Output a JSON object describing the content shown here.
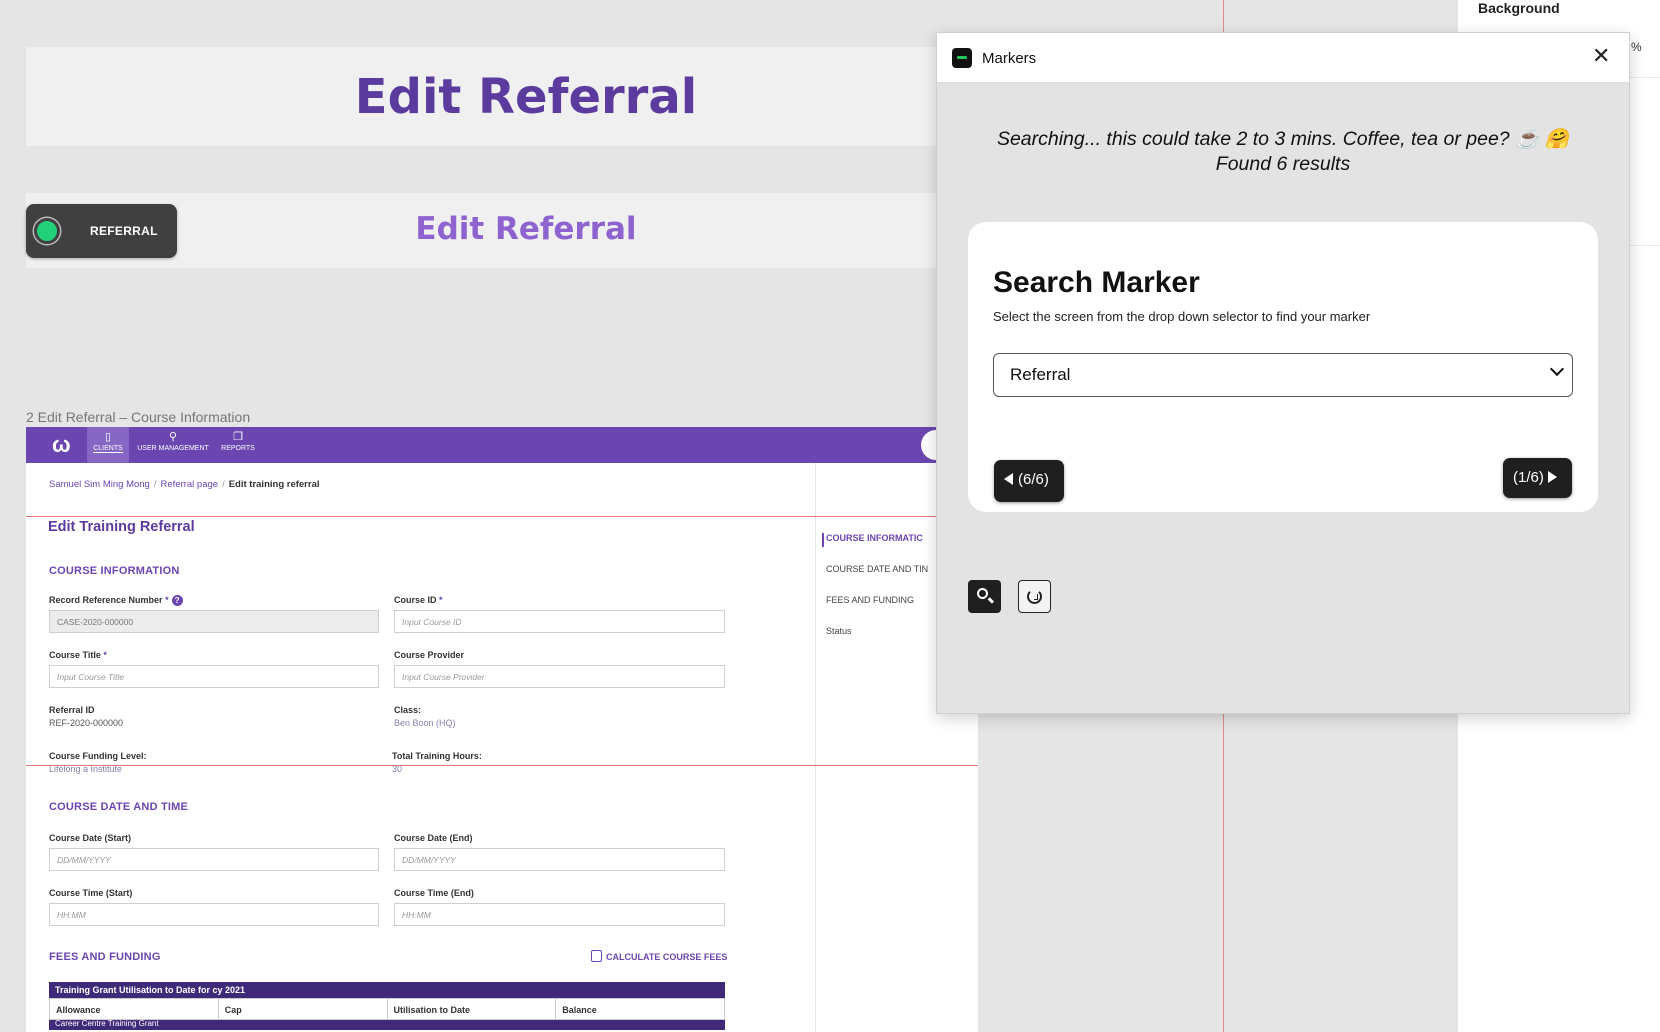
{
  "design_panel": {
    "background_label": "Background",
    "percent_fragment": "%"
  },
  "banners": {
    "main_title": "Edit Referral",
    "sub_title": "Edit Referral",
    "marker_pill_label": "REFERRAL",
    "marker_pill_color": "#22d07a"
  },
  "frame": {
    "label": "2 Edit Referral – Course Information"
  },
  "app": {
    "nav": {
      "logo": "ω",
      "items": [
        {
          "label": "CLIENTS",
          "icon": "clients-icon"
        },
        {
          "label": "USER MANAGEMENT",
          "icon": "user-icon"
        },
        {
          "label": "REPORTS",
          "icon": "reports-icon"
        }
      ]
    },
    "breadcrumb": [
      "Samuel Sim Ming Mong",
      "Referral page",
      "Edit training referral"
    ],
    "page_title": "Edit Training Referral",
    "side_nav": [
      "COURSE INFORMATIC",
      "COURSE DATE AND TIN",
      "FEES AND FUNDING",
      "Status"
    ],
    "sections": {
      "course_info": "COURSE INFORMATION",
      "course_date": "COURSE DATE AND TIME",
      "fees": "FEES AND FUNDING"
    },
    "fields": {
      "record_ref_label": "Record Reference Number",
      "record_ref_value": "CASE-2020-000000",
      "course_id_label": "Course ID",
      "course_id_placeholder": "Input Course ID",
      "course_title_label": "Course Title",
      "course_title_placeholder": "Input Course Title",
      "course_provider_label": "Course Provider",
      "course_provider_placeholder": "Input Course Provider",
      "referral_id_label": "Referral ID",
      "referral_id_value": "REF-2020-000000",
      "class_label": "Class:",
      "class_value": "Ben Boon (HQ)",
      "funding_level_label": "Course Funding Level:",
      "funding_level_value": "Lifelong a Institute",
      "total_hours_label": "Total Training Hours:",
      "total_hours_value": "30",
      "date_start_label": "Course Date (Start)",
      "date_start_placeholder": "DD/MM/YYYY",
      "date_end_label": "Course Date (End)",
      "date_end_placeholder": "DD/MM/YYYY",
      "time_start_label": "Course Time (Start)",
      "time_start_placeholder": "HH:MM",
      "time_end_label": "Course Time (End)",
      "time_end_placeholder": "HH:MM"
    },
    "calculate_label": "CALCULATE COURSE FEES",
    "grant_table": {
      "title": "Training Grant Utilisation to Date for cy 2021",
      "columns": [
        "Allowance",
        "Cap",
        "Utilisation to Date",
        "Balance"
      ],
      "sub_header": "Career Centre Training Grant"
    }
  },
  "markers_popup": {
    "title": "Markers",
    "status_line1": "Searching... this could take 2 to 3 mins. Coffee, tea or pee? ☕ 🤗",
    "status_line2": "Found 6 results",
    "card_title": "Search Marker",
    "card_subtitle": "Select the screen from the drop down selector to find your marker",
    "selected_screen": "Referral",
    "prev_label": "(6/6)",
    "next_label": "(1/6)"
  }
}
